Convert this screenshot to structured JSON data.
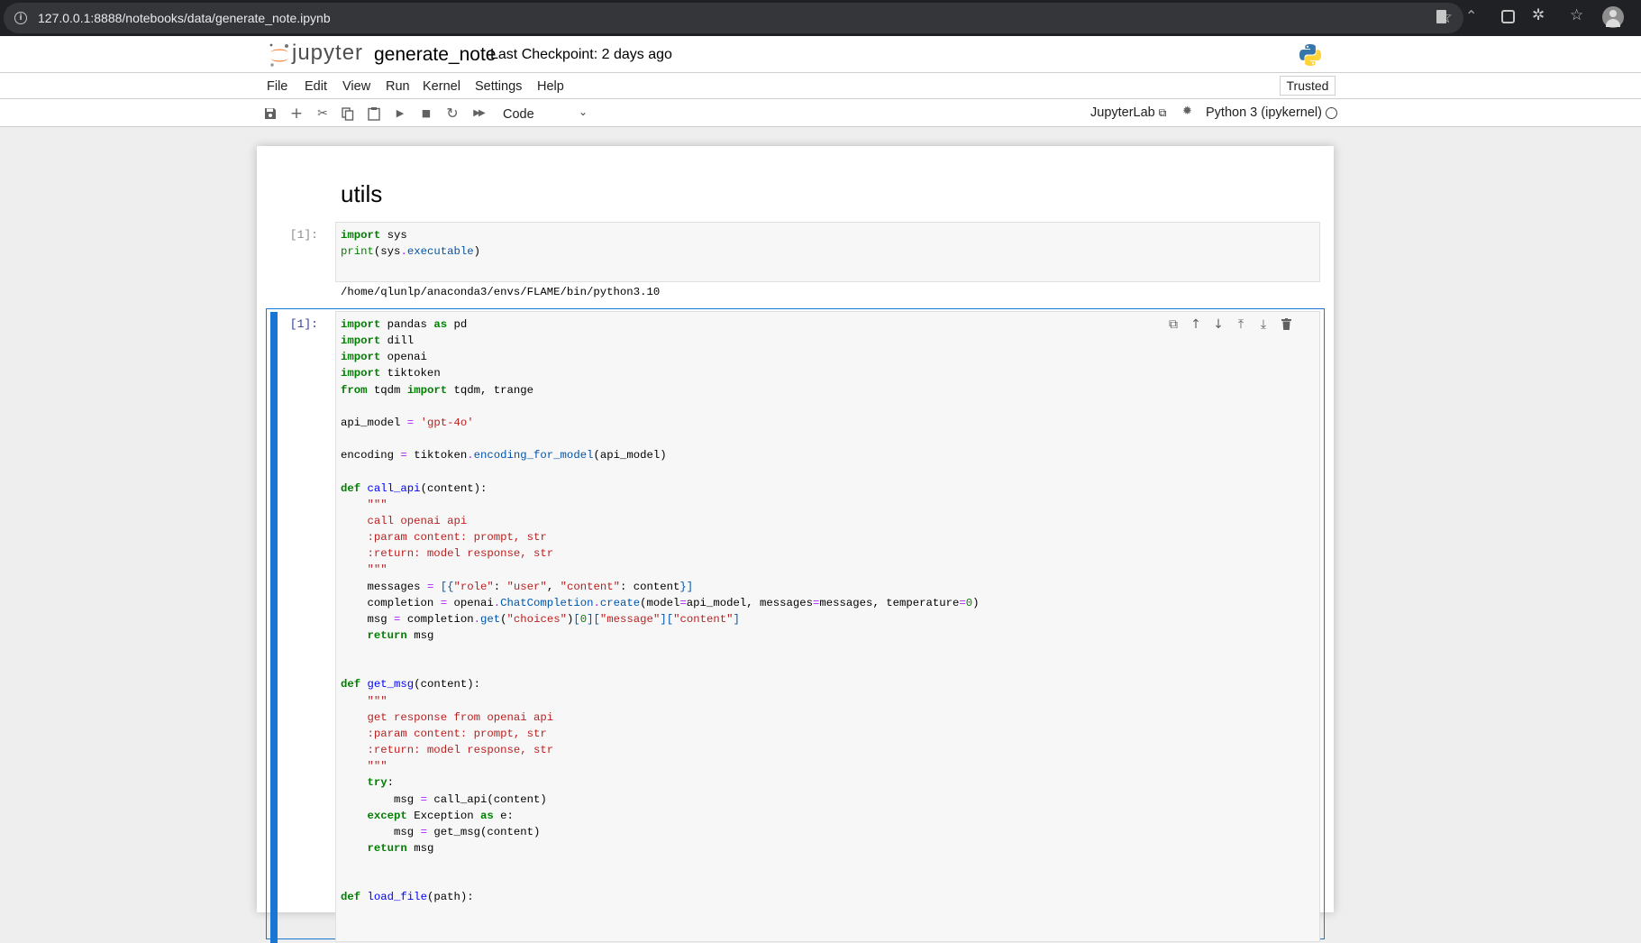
{
  "browser": {
    "url": "127.0.0.1:8888/notebooks/data/generate_note.ipynb",
    "icons": [
      "info-icon",
      "bookmark-star-icon",
      "document-icon",
      "graduation-cap-icon",
      "box-extension-icon",
      "puzzle-icon",
      "favorites-icon",
      "profile-avatar"
    ]
  },
  "header": {
    "logo_text": "jupyter",
    "notebook_name": "generate_note",
    "checkpoint": "Last Checkpoint: 2 days ago",
    "trusted_label": "Trusted",
    "python_logo": "python-logo-icon"
  },
  "menu": {
    "items": [
      "File",
      "Edit",
      "View",
      "Run",
      "Kernel",
      "Settings",
      "Help"
    ]
  },
  "toolbar": {
    "buttons": [
      "save-icon",
      "insert-cell-icon",
      "cut-icon",
      "copy-icon",
      "paste-icon",
      "run-icon",
      "interrupt-icon",
      "restart-icon",
      "restart-run-all-icon"
    ],
    "cell_type": "Code",
    "jupyterlab_link": "JupyterLab",
    "kernel": "Python 3 (ipykernel)",
    "colors": {
      "accent": "#1976d2",
      "orange": "#f37726"
    }
  },
  "notebook": {
    "heading": "utils",
    "cell1": {
      "prompt": "[1]:",
      "output": "/home/qlunlp/anaconda3/envs/FLAME/bin/python3.10"
    },
    "cell2": {
      "prompt": "[1]:",
      "tools": [
        "duplicate-icon",
        "move-up-icon",
        "move-down-icon",
        "insert-above-icon",
        "insert-below-icon",
        "delete-icon"
      ]
    }
  }
}
